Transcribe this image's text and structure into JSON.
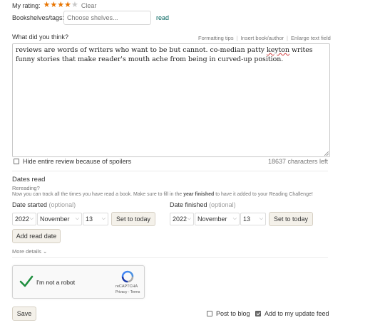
{
  "rating": {
    "label": "My rating:",
    "stars_filled": 4,
    "stars_total": 5,
    "clear_label": "Clear"
  },
  "shelves": {
    "label": "Bookshelves/tags:",
    "placeholder": "Choose shelves...",
    "current_shelf": "read"
  },
  "review": {
    "label": "What did you think?",
    "links": [
      "Formatting tips",
      "Insert book/author",
      "Enlarge text field"
    ],
    "separator": "|",
    "text_part1": "reviews are words of writers who want to be but cannot. co-median patty ",
    "text_misspelled": "keyton",
    "text_part2": " writes funny stories that make reader's mouth ache from being in curved-up position.",
    "chars_left": "18637 characters left"
  },
  "spoiler": {
    "label": "Hide entire review because of spoilers",
    "checked": false
  },
  "dates": {
    "heading": "Dates read",
    "rereading": "Rereading?",
    "info_prefix": "Now you can track all the times you have read a book. Make sure to fill in the ",
    "info_bold": "year finished",
    "info_suffix": " to have it added to your Reading Challenge!",
    "started": {
      "label": "Date started",
      "optional": "(optional)",
      "year": "2022",
      "month": "November",
      "day": "13",
      "today_label": "Set to today"
    },
    "finished": {
      "label": "Date finished",
      "optional": "(optional)",
      "year": "2022",
      "month": "November",
      "day": "13",
      "today_label": "Set to today"
    },
    "add_read_date": "Add read date",
    "more_details": "More details",
    "more_details_chevron": "⌄"
  },
  "captcha": {
    "label": "I'm not a robot",
    "brand": "reCAPTCHA",
    "footer": "Privacy - Terms",
    "check_color": "#1e8e3e"
  },
  "footer": {
    "save_label": "Save",
    "post_to_blog": "Post to blog",
    "post_to_blog_checked": false,
    "update_feed": "Add to my update feed",
    "update_feed_checked": true
  },
  "colors": {
    "star": "#e87400",
    "link": "#00635d",
    "button_bg": "#f4f1ea"
  }
}
